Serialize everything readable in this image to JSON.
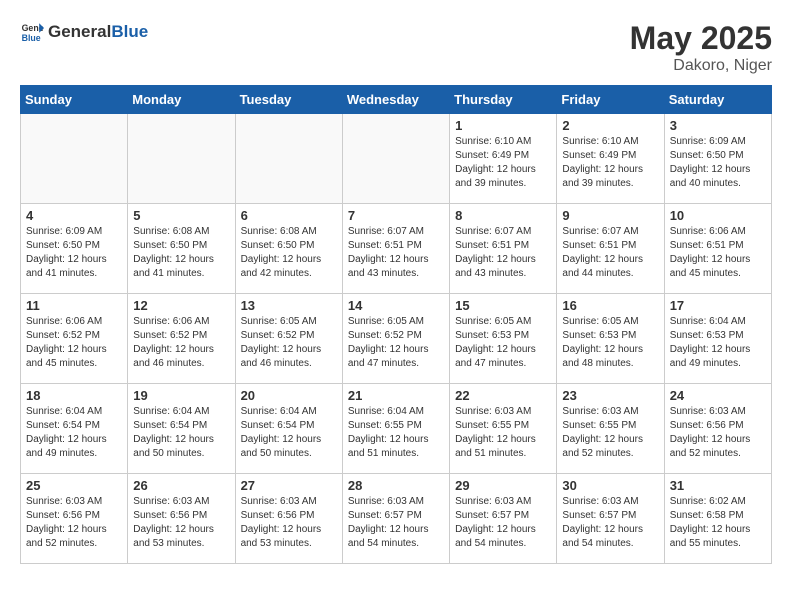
{
  "header": {
    "logo_general": "General",
    "logo_blue": "Blue",
    "title": "May 2025",
    "location": "Dakoro, Niger"
  },
  "weekdays": [
    "Sunday",
    "Monday",
    "Tuesday",
    "Wednesday",
    "Thursday",
    "Friday",
    "Saturday"
  ],
  "weeks": [
    [
      {
        "day": "",
        "info": ""
      },
      {
        "day": "",
        "info": ""
      },
      {
        "day": "",
        "info": ""
      },
      {
        "day": "",
        "info": ""
      },
      {
        "day": "1",
        "info": "Sunrise: 6:10 AM\nSunset: 6:49 PM\nDaylight: 12 hours and 39 minutes."
      },
      {
        "day": "2",
        "info": "Sunrise: 6:10 AM\nSunset: 6:49 PM\nDaylight: 12 hours and 39 minutes."
      },
      {
        "day": "3",
        "info": "Sunrise: 6:09 AM\nSunset: 6:50 PM\nDaylight: 12 hours and 40 minutes."
      }
    ],
    [
      {
        "day": "4",
        "info": "Sunrise: 6:09 AM\nSunset: 6:50 PM\nDaylight: 12 hours and 41 minutes."
      },
      {
        "day": "5",
        "info": "Sunrise: 6:08 AM\nSunset: 6:50 PM\nDaylight: 12 hours and 41 minutes."
      },
      {
        "day": "6",
        "info": "Sunrise: 6:08 AM\nSunset: 6:50 PM\nDaylight: 12 hours and 42 minutes."
      },
      {
        "day": "7",
        "info": "Sunrise: 6:07 AM\nSunset: 6:51 PM\nDaylight: 12 hours and 43 minutes."
      },
      {
        "day": "8",
        "info": "Sunrise: 6:07 AM\nSunset: 6:51 PM\nDaylight: 12 hours and 43 minutes."
      },
      {
        "day": "9",
        "info": "Sunrise: 6:07 AM\nSunset: 6:51 PM\nDaylight: 12 hours and 44 minutes."
      },
      {
        "day": "10",
        "info": "Sunrise: 6:06 AM\nSunset: 6:51 PM\nDaylight: 12 hours and 45 minutes."
      }
    ],
    [
      {
        "day": "11",
        "info": "Sunrise: 6:06 AM\nSunset: 6:52 PM\nDaylight: 12 hours and 45 minutes."
      },
      {
        "day": "12",
        "info": "Sunrise: 6:06 AM\nSunset: 6:52 PM\nDaylight: 12 hours and 46 minutes."
      },
      {
        "day": "13",
        "info": "Sunrise: 6:05 AM\nSunset: 6:52 PM\nDaylight: 12 hours and 46 minutes."
      },
      {
        "day": "14",
        "info": "Sunrise: 6:05 AM\nSunset: 6:52 PM\nDaylight: 12 hours and 47 minutes."
      },
      {
        "day": "15",
        "info": "Sunrise: 6:05 AM\nSunset: 6:53 PM\nDaylight: 12 hours and 47 minutes."
      },
      {
        "day": "16",
        "info": "Sunrise: 6:05 AM\nSunset: 6:53 PM\nDaylight: 12 hours and 48 minutes."
      },
      {
        "day": "17",
        "info": "Sunrise: 6:04 AM\nSunset: 6:53 PM\nDaylight: 12 hours and 49 minutes."
      }
    ],
    [
      {
        "day": "18",
        "info": "Sunrise: 6:04 AM\nSunset: 6:54 PM\nDaylight: 12 hours and 49 minutes."
      },
      {
        "day": "19",
        "info": "Sunrise: 6:04 AM\nSunset: 6:54 PM\nDaylight: 12 hours and 50 minutes."
      },
      {
        "day": "20",
        "info": "Sunrise: 6:04 AM\nSunset: 6:54 PM\nDaylight: 12 hours and 50 minutes."
      },
      {
        "day": "21",
        "info": "Sunrise: 6:04 AM\nSunset: 6:55 PM\nDaylight: 12 hours and 51 minutes."
      },
      {
        "day": "22",
        "info": "Sunrise: 6:03 AM\nSunset: 6:55 PM\nDaylight: 12 hours and 51 minutes."
      },
      {
        "day": "23",
        "info": "Sunrise: 6:03 AM\nSunset: 6:55 PM\nDaylight: 12 hours and 52 minutes."
      },
      {
        "day": "24",
        "info": "Sunrise: 6:03 AM\nSunset: 6:56 PM\nDaylight: 12 hours and 52 minutes."
      }
    ],
    [
      {
        "day": "25",
        "info": "Sunrise: 6:03 AM\nSunset: 6:56 PM\nDaylight: 12 hours and 52 minutes."
      },
      {
        "day": "26",
        "info": "Sunrise: 6:03 AM\nSunset: 6:56 PM\nDaylight: 12 hours and 53 minutes."
      },
      {
        "day": "27",
        "info": "Sunrise: 6:03 AM\nSunset: 6:56 PM\nDaylight: 12 hours and 53 minutes."
      },
      {
        "day": "28",
        "info": "Sunrise: 6:03 AM\nSunset: 6:57 PM\nDaylight: 12 hours and 54 minutes."
      },
      {
        "day": "29",
        "info": "Sunrise: 6:03 AM\nSunset: 6:57 PM\nDaylight: 12 hours and 54 minutes."
      },
      {
        "day": "30",
        "info": "Sunrise: 6:03 AM\nSunset: 6:57 PM\nDaylight: 12 hours and 54 minutes."
      },
      {
        "day": "31",
        "info": "Sunrise: 6:02 AM\nSunset: 6:58 PM\nDaylight: 12 hours and 55 minutes."
      }
    ]
  ]
}
